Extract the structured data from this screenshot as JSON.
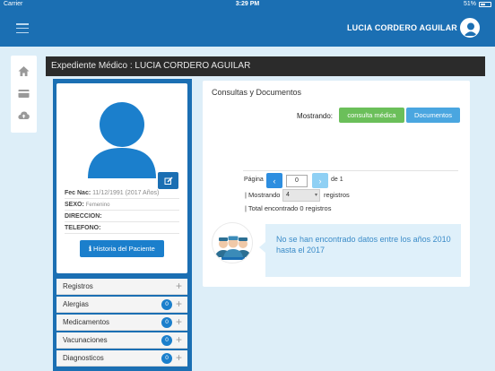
{
  "status_bar": {
    "carrier": "Carrier",
    "time": "3:29 PM",
    "battery": "51%",
    "battery_level": 0.51
  },
  "header": {
    "username": "LUCIA CORDERO AGUILAR",
    "menu_icon": "hamburger-icon",
    "avatar_icon": "user-avatar-icon"
  },
  "sidenav": {
    "items": [
      {
        "icon": "home-icon"
      },
      {
        "icon": "credit-card-icon"
      },
      {
        "icon": "cloud-upload-icon"
      }
    ]
  },
  "page": {
    "title": "Expediente Médico : LUCIA CORDERO AGUILAR"
  },
  "profile": {
    "fec_nac_label": "Fec Nac:",
    "fec_nac_value": "11/12/1991 (2017 Años)",
    "sexo_label": "SEXO:",
    "sexo_value": "Femenino",
    "direccion_label": "DIRECCION:",
    "telefono_label": "TELEFONO:",
    "historia_button": "Historia del Paciente"
  },
  "accordion": [
    {
      "label": "Registros",
      "count": null
    },
    {
      "label": "Alergias",
      "count": "0"
    },
    {
      "label": "Medicamentos",
      "count": "0"
    },
    {
      "label": "Vacunaciones",
      "count": "0"
    },
    {
      "label": "Diagnosticos",
      "count": "0"
    }
  ],
  "main": {
    "heading": "Consultas y Documentos",
    "mostrando_label": "Mostrando:",
    "tab_consulta": "consulta médica",
    "tab_documentos": "Documentos",
    "pagina_label": "Página",
    "page_value": "0",
    "of_label": "de 1",
    "mostrando_row_label": "| Mostrando",
    "per_page": "4",
    "registros_label": "registros",
    "total_label": "| Total encontrado 0 registros",
    "message": "No se han encontrado datos entre los años 2010 hasta el 2017"
  },
  "colors": {
    "primary": "#1b6fb3",
    "success": "#6bbf5a",
    "info": "#4aa6e0",
    "dark": "#2b2b2b",
    "background": "#ddeef8"
  }
}
